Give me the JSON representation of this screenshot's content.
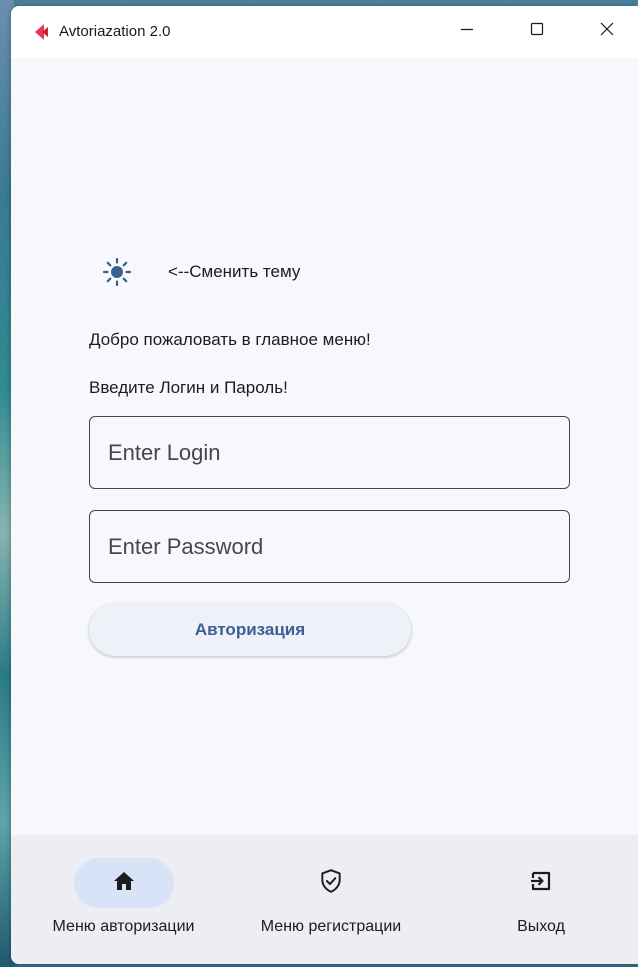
{
  "window": {
    "title": "Avtoriazation 2.0",
    "app_icon": "red-arrow-logo-icon",
    "controls": {
      "minimize_icon": "minimize-icon",
      "maximize_icon": "maximize-icon",
      "close_icon": "close-icon"
    }
  },
  "theme": {
    "icon": "sun-icon",
    "label": "<--Сменить тему"
  },
  "main": {
    "welcome_text": "Добро пожаловать в главное меню!",
    "prompt_text": "Введите Логин и Пароль!",
    "login": {
      "placeholder": "Enter Login",
      "value": ""
    },
    "password": {
      "placeholder": "Enter Password",
      "value": ""
    },
    "auth_button_label": "Авторизация"
  },
  "navbar": {
    "items": [
      {
        "label": "Меню авторизации",
        "icon": "home-icon",
        "active": true
      },
      {
        "label": "Меню регистрации",
        "icon": "shield-check-icon",
        "active": false
      },
      {
        "label": "Выход",
        "icon": "exit-icon",
        "active": false
      }
    ]
  },
  "colors": {
    "accent": "#3c5f93",
    "active_pill": "#d8e3f8",
    "background": "#f6f8fc",
    "navbar_background": "#eceef4",
    "logo_red": "#e8384f"
  }
}
